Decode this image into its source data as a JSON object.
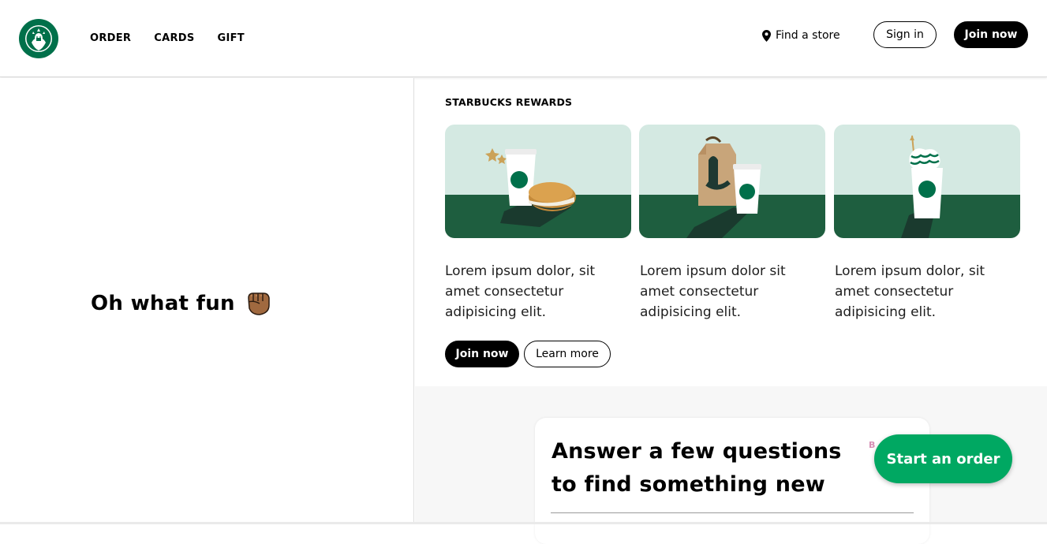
{
  "header": {
    "logo_alt": "Starbucks",
    "nav": [
      {
        "label": "ORDER"
      },
      {
        "label": "CARDS"
      },
      {
        "label": "GIFT"
      }
    ],
    "find_store": "Find a store",
    "sign_in": "Sign in",
    "join_now": "Join now"
  },
  "hero": {
    "title": "Oh what fun",
    "emoji": "fist-icon"
  },
  "rewards": {
    "label": "STARBUCKS REWARDS",
    "cards": [
      {
        "text": "Lorem ipsum dolor, sit amet consectetur adipisicing elit.",
        "illustration": "coffee-and-sandwich"
      },
      {
        "text": "Lorem ipsum dolor sit amet consectetur adipisicing elit.",
        "illustration": "bag-and-cup"
      },
      {
        "text": "Lorem ipsum dolor, sit amet consectetur adipisicing elit.",
        "illustration": "frappuccino"
      }
    ],
    "join_now": "Join now",
    "learn_more": "Learn more"
  },
  "quiz": {
    "title": "Answer a few questions to find something new",
    "badge": "B"
  },
  "fab": {
    "label": "Start an order"
  },
  "colors": {
    "brand_green": "#00704a",
    "dark_green": "#1e3932",
    "house_green": "#006241",
    "accent_green": "#00a862",
    "mint": "#d4e9e2"
  }
}
